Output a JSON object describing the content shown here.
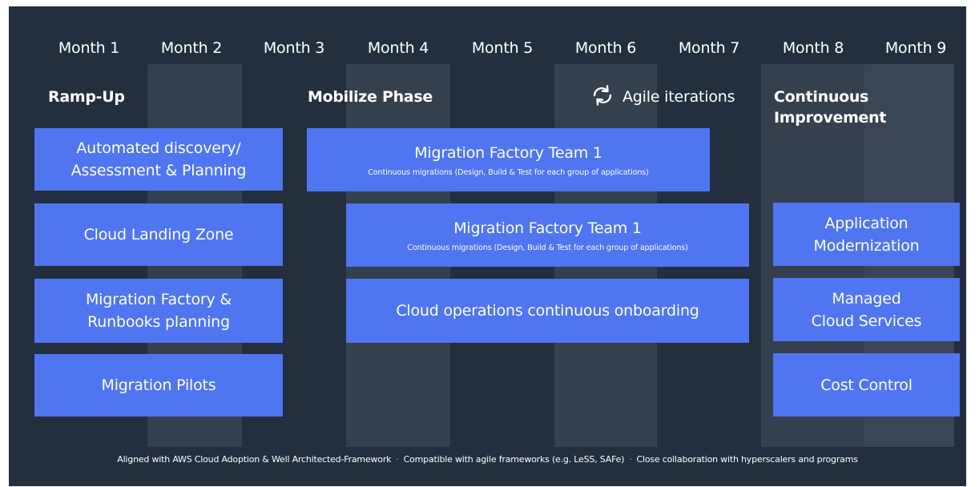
{
  "months": [
    "Month 1",
    "Month 2",
    "Month 3",
    "Month 4",
    "Month 5",
    "Month 6",
    "Month 7",
    "Month 8",
    "Month 9"
  ],
  "phases": {
    "ramp_up": "Ramp-Up",
    "mobilize": "Mobilize Phase",
    "agile_iterations": "Agile iterations",
    "continuous_improvement": "Continuous\nImprovement"
  },
  "boxes": {
    "discovery": "Automated discovery/\nAssessment & Planning",
    "landing_zone": "Cloud Landing Zone",
    "factory_planning": "Migration Factory &\nRunbooks planning",
    "pilots": "Migration Pilots",
    "factory_team_a": {
      "title": "Migration Factory Team 1",
      "subtitle": "Continuous migrations (Design, Build & Test for each group of applications)"
    },
    "factory_team_b": {
      "title": "Migration Factory Team 1",
      "subtitle": "Continuous migrations (Design, Build & Test for each group of applications)"
    },
    "cloud_ops": "Cloud operations continuous onboarding",
    "app_modernization": "Application\nModernization",
    "managed_services": "Managed\nCloud Services",
    "cost_control": "Cost Control"
  },
  "footer": {
    "items": [
      "Aligned with AWS Cloud Adoption & Well Architected-Framework",
      "Compatible with agile frameworks (e.g. LeSS, SAFe)",
      "Close collaboration with hyperscalers and programs"
    ],
    "separator": "·"
  },
  "icons": {
    "agile": "cycle-arrows-icon"
  },
  "colors": {
    "background": "#232f3e",
    "column_band": "#35404f",
    "box": "#4f75f0",
    "text": "#ffffff"
  }
}
